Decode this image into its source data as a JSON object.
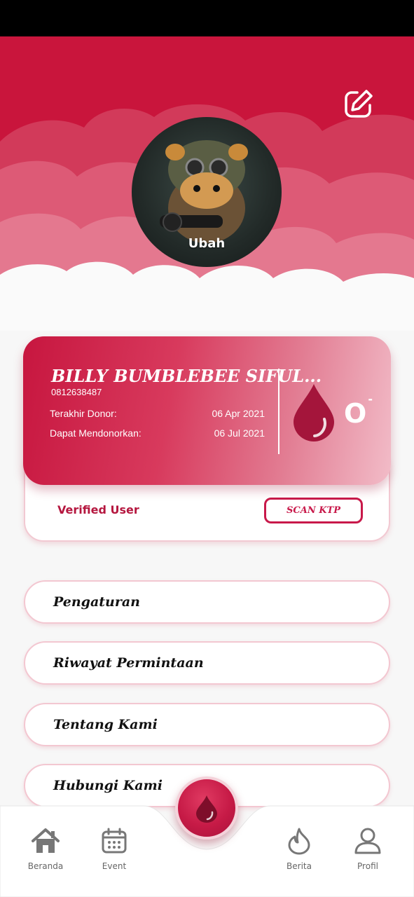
{
  "profile": {
    "avatar_label": "Ubah",
    "name": "BILLY BUMBLEBEE SIFUL...",
    "phone": "0812638487",
    "last_donor_label": "Terakhir Donor:",
    "last_donor_value": "06 Apr 2021",
    "can_donate_label": "Dapat Mendonorkan:",
    "can_donate_value": "06 Jul 2021",
    "blood_type": "O",
    "rhesus": "-",
    "verified_label": "Verified User",
    "scan_button": "SCAN KTP"
  },
  "menu": [
    {
      "label": "Pengaturan"
    },
    {
      "label": "Riwayat Permintaan"
    },
    {
      "label": "Tentang Kami"
    },
    {
      "label": "Hubungi Kami"
    }
  ],
  "nav": {
    "items": [
      {
        "label": "Beranda",
        "icon": "home-icon"
      },
      {
        "label": "Event",
        "icon": "calendar-icon"
      },
      {
        "label": "Berita",
        "icon": "flame-icon"
      },
      {
        "label": "Profil",
        "icon": "user-icon"
      }
    ],
    "center_icon": "blood-drop-icon"
  },
  "colors": {
    "primary": "#c8194a",
    "header_dark": "#c9153c",
    "menu_border": "#f3c7d1"
  }
}
